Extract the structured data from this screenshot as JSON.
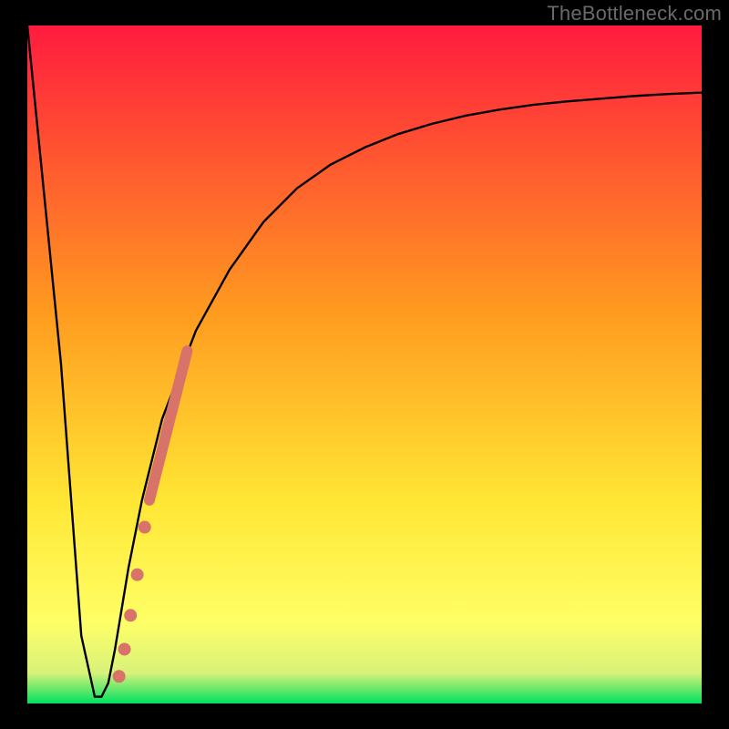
{
  "watermark": "TheBottleneck.com",
  "chart_data": {
    "type": "line",
    "description": "Bottleneck percentage curve over a heatmap gradient. V-shaped curve with a sharp minimum near the low end of x, rising toward saturation on the right. A cluster of data points (salmon dots and a thick salmon segment) sits on the rising branch at low bottleneck values.",
    "x": [
      0,
      5,
      8,
      10,
      11,
      12,
      13,
      14,
      15,
      17,
      20,
      25,
      30,
      35,
      40,
      45,
      50,
      55,
      60,
      65,
      70,
      75,
      80,
      85,
      90,
      95,
      100
    ],
    "values": [
      100,
      50,
      10,
      1,
      1,
      3,
      8,
      14,
      20,
      30,
      42,
      55,
      64,
      71,
      76,
      79.5,
      82,
      84,
      85.5,
      86.7,
      87.6,
      88.3,
      88.8,
      89.2,
      89.6,
      89.9,
      90.1
    ],
    "series": [
      {
        "name": "bottleneck-curve",
        "role": "line"
      },
      {
        "name": "data-points",
        "role": "scatter",
        "x": [
          13.6,
          14.4,
          15.3,
          16.3,
          17.4
        ],
        "y": [
          4,
          8,
          13,
          19,
          26
        ]
      },
      {
        "name": "dense-segment",
        "role": "thick-line",
        "x": [
          18.1,
          23.7
        ],
        "y": [
          30,
          52
        ]
      }
    ],
    "title": "",
    "xlabel": "",
    "ylabel": "",
    "xlim": [
      0,
      100
    ],
    "ylim": [
      0,
      100
    ],
    "colors": {
      "curve": "#000000",
      "points": "#d77368",
      "gradient_top": "#ff1b3f",
      "gradient_mid1": "#ff9a1f",
      "gradient_mid2": "#ffe634",
      "gradient_bottom": "#00e060",
      "frame": "#000000"
    }
  }
}
